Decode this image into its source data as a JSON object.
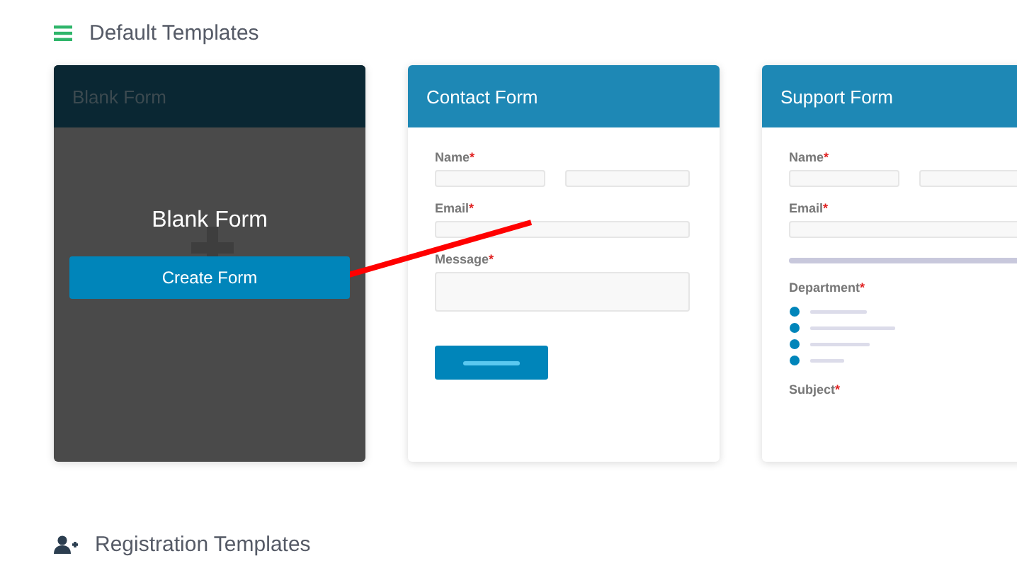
{
  "sections": [
    {
      "kind": "list",
      "title": "Default Templates"
    },
    {
      "kind": "user-add",
      "title": "Registration Templates"
    }
  ],
  "cards": [
    {
      "kind": "blank",
      "title": "Blank Form",
      "body_title": "Blank Form",
      "button": "Create Form"
    },
    {
      "kind": "preview",
      "title": "Contact Form",
      "fields": [
        {
          "kind": "name-pair",
          "label": "Name",
          "required_mark": "*"
        },
        {
          "kind": "input",
          "label": "Email",
          "required_mark": "*"
        },
        {
          "kind": "textarea",
          "label": "Message",
          "required_mark": "*"
        },
        {
          "kind": "submit"
        }
      ]
    },
    {
      "kind": "preview",
      "title": "Support Form",
      "fields": [
        {
          "kind": "name-pair",
          "label": "Name",
          "required_mark": "*"
        },
        {
          "kind": "input",
          "label": "Email",
          "required_mark": "*"
        },
        {
          "kind": "bar"
        },
        {
          "kind": "radios",
          "label": "Department",
          "required_mark": "*"
        },
        {
          "kind": "label",
          "label": "Subject",
          "required_mark": "*"
        }
      ]
    }
  ]
}
